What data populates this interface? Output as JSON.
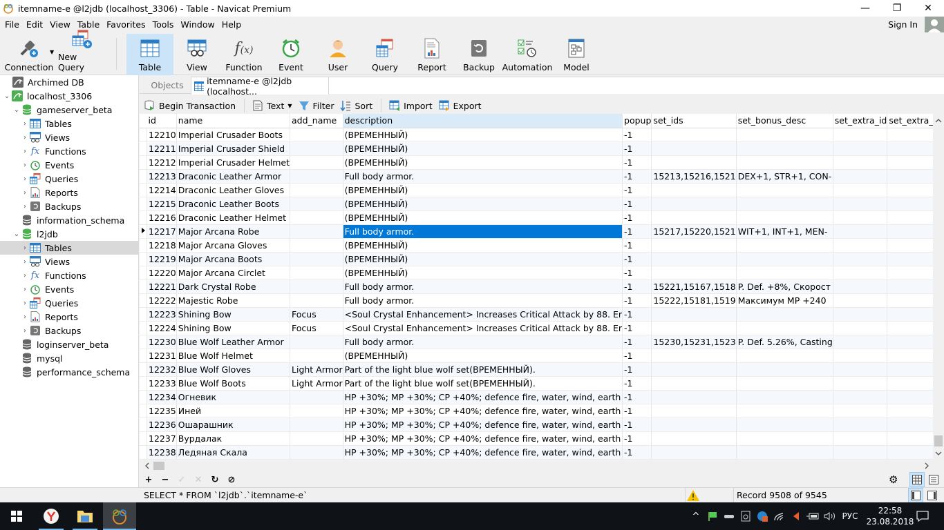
{
  "window": {
    "title": "itemname-e @l2jdb (localhost_3306) - Table - Navicat Premium",
    "minimize": "—",
    "restore": "❐",
    "close": "✕"
  },
  "menu": [
    "File",
    "Edit",
    "View",
    "Table",
    "Favorites",
    "Tools",
    "Window",
    "Help"
  ],
  "account": {
    "sign_in": "Sign In"
  },
  "toolbar": {
    "connection": "Connection",
    "new_query": "New Query",
    "table": "Table",
    "view": "View",
    "function": "Function",
    "event": "Event",
    "user": "User",
    "query": "Query",
    "report": "Report",
    "backup": "Backup",
    "automation": "Automation",
    "model": "Model",
    "active": "Table"
  },
  "tree": {
    "archimed": "Archimed DB",
    "localhost": "localhost_3306",
    "gameserver": "gameserver_beta",
    "gs_children": [
      "Tables",
      "Views",
      "Functions",
      "Events",
      "Queries",
      "Reports",
      "Backups"
    ],
    "information_schema": "information_schema",
    "l2jdb": "l2jdb",
    "l2_children": [
      "Tables",
      "Views",
      "Functions",
      "Events",
      "Queries",
      "Reports",
      "Backups"
    ],
    "loginserver": "loginserver_beta",
    "mysql": "mysql",
    "performance": "performance_schema",
    "selected": "l2jdb / Tables"
  },
  "tabs": {
    "objects": "Objects",
    "active": "itemname-e @l2jdb (localhost..."
  },
  "subtoolbar": {
    "begin_transaction": "Begin Transaction",
    "text": "Text",
    "filter": "Filter",
    "sort": "Sort",
    "import": "Import",
    "export": "Export"
  },
  "grid": {
    "columns": [
      "id",
      "name",
      "add_name",
      "description",
      "popup",
      "set_ids",
      "set_bonus_desc",
      "set_extra_id",
      "set_extra_desc"
    ],
    "highlighted_column": "description",
    "selected_row_id": "12217",
    "rows": [
      [
        "12210",
        "Imperial Crusader Boots",
        "",
        "(ВРЕМЕННЫЙ)",
        "-1",
        "",
        "",
        "",
        ""
      ],
      [
        "12211",
        "Imperial Crusader Shield",
        "",
        "(ВРЕМЕННЫЙ)",
        "-1",
        "",
        "",
        "",
        ""
      ],
      [
        "12212",
        "Imperial Crusader Helmet",
        "",
        "(ВРЕМЕННЫЙ)",
        "-1",
        "",
        "",
        "",
        ""
      ],
      [
        "12213",
        "Draconic Leather Armor",
        "",
        "Full body armor.",
        "-1",
        "15213,15216,1521",
        "DEX+1, STR+1, CON-",
        "",
        ""
      ],
      [
        "12214",
        "Draconic Leather Gloves",
        "",
        "(ВРЕМЕННЫЙ)",
        "-1",
        "",
        "",
        "",
        ""
      ],
      [
        "12215",
        "Draconic Leather Boots",
        "",
        "(ВРЕМЕННЫЙ)",
        "-1",
        "",
        "",
        "",
        ""
      ],
      [
        "12216",
        "Draconic Leather Helmet",
        "",
        "(ВРЕМЕННЫЙ)",
        "-1",
        "",
        "",
        "",
        ""
      ],
      [
        "12217",
        "Major Arcana Robe",
        "",
        "Full body armor.",
        "-1",
        "15217,15220,1521",
        "WIT+1, INT+1, MEN-",
        "",
        ""
      ],
      [
        "12218",
        "Major Arcana Gloves",
        "",
        "(ВРЕМЕННЫЙ)",
        "-1",
        "",
        "",
        "",
        ""
      ],
      [
        "12219",
        "Major Arcana Boots",
        "",
        "(ВРЕМЕННЫЙ)",
        "-1",
        "",
        "",
        "",
        ""
      ],
      [
        "12220",
        "Major Arcana Circlet",
        "",
        "(ВРЕМЕННЫЙ)",
        "-1",
        "",
        "",
        "",
        ""
      ],
      [
        "12221",
        "Dark Crystal Robe",
        "",
        "Full body armor.",
        "-1",
        "15221,15167,1518",
        "P. Def. +8%, Скорост",
        "",
        ""
      ],
      [
        "12222",
        "Majestic Robe",
        "",
        "Full body armor.",
        "-1",
        "15222,15181,1519",
        "Максимум MP +240",
        "",
        ""
      ],
      [
        "12223",
        "Shining Bow",
        "Focus",
        "<Soul Crystal Enhancement> Increases Critical Attack by 88. Er",
        "-1",
        "",
        "",
        "",
        ""
      ],
      [
        "12224",
        "Shining Bow",
        "Focus",
        "<Soul Crystal Enhancement> Increases Critical Attack by 88. Er",
        "-1",
        "",
        "",
        "",
        ""
      ],
      [
        "12230",
        "Blue Wolf Leather Armor",
        "",
        "Full body armor.",
        "-1",
        "15230,15231,1523",
        "P. Def. 5.26%, Casting",
        "",
        ""
      ],
      [
        "12231",
        "Blue Wolf Helmet",
        "",
        "(ВРЕМЕННЫЙ)",
        "-1",
        "",
        "",
        "",
        ""
      ],
      [
        "12232",
        "Blue Wolf Gloves",
        "Light Armor",
        "Part of the light blue wolf set(ВРЕМЕННЫЙ).",
        "-1",
        "",
        "",
        "",
        ""
      ],
      [
        "12233",
        "Blue Wolf Boots",
        "Light Armor",
        "Part of the light blue wolf set(ВРЕМЕННЫЙ).",
        "-1",
        "",
        "",
        "",
        ""
      ],
      [
        "12234",
        "Огневик",
        "",
        "HP +30%; MP +30%; CP +40%; defence fire, water, wind, earth",
        "-1",
        "",
        "",
        "",
        ""
      ],
      [
        "12235",
        "Иней",
        "",
        "HP +30%; MP +30%; CP +40%; defence fire, water, wind, earth",
        "-1",
        "",
        "",
        "",
        ""
      ],
      [
        "12236",
        "Ошарашник",
        "",
        "HP +30%; MP +30%; CP +40%; defence fire, water, wind, earth",
        "-1",
        "",
        "",
        "",
        ""
      ],
      [
        "12237",
        "Вурдалак",
        "",
        "HP +30%; MP +30%; CP +40%; defence fire, water, wind, earth",
        "-1",
        "",
        "",
        "",
        ""
      ],
      [
        "12238",
        "Ледяная Скала",
        "",
        "HP +30%; MP +30%; CP +40%; defence fire, water, wind, earth",
        "-1",
        "",
        "",
        "",
        ""
      ]
    ]
  },
  "status": {
    "sql": "SELECT * FROM `l2jdb`.`itemname-e`",
    "record": "Record 9508 of 9545"
  },
  "taskbar": {
    "language": "РУС",
    "time": "22:58",
    "date": "23.08.2018"
  },
  "colors": {
    "selection": "#0078d7",
    "active_tool": "#cce4f7",
    "db_green": "#4caf50"
  }
}
